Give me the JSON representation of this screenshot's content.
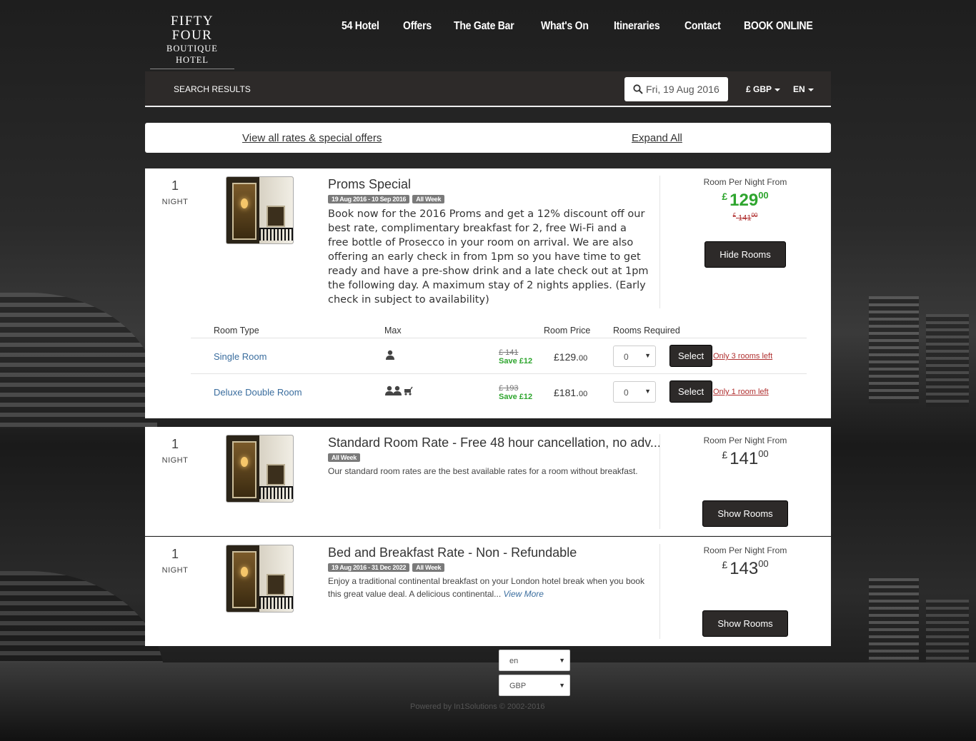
{
  "logo": {
    "line1": "FIFTY FOUR",
    "line2": "BOUTIQUE HOTEL"
  },
  "nav": [
    "54 Hotel",
    "Offers",
    "The Gate Bar",
    "What's On",
    "Itineraries",
    "Contact",
    "BOOK ONLINE"
  ],
  "search": {
    "title": "SEARCH RESULTS",
    "date": "Fri, 19 Aug 2016",
    "currency": "£ GBP",
    "language": "EN"
  },
  "links": {
    "view_all": "View all rates & special offers",
    "expand": "Expand All"
  },
  "rates": [
    {
      "nights": "1",
      "nights_label": "NIGHT",
      "title": "Proms Special",
      "badges": [
        "19 Aug 2016 - 10 Sep 2016",
        "All Week"
      ],
      "description": "Book now for the 2016 Proms and get a 12% discount off our best rate, complimentary breakfast for 2, free Wi-Fi and a free bottle of Prosecco in your room on arrival. We are also offering an early check in from 1pm so you have time to get ready and have a pre-show drink and a late check out at 1pm the following day. A maximum stay of 2 nights applies. (Early check in subject to availability)",
      "from_label": "Room Per Night From",
      "currency_symbol": "£",
      "price_main": "129",
      "price_cents": "00",
      "old_currency": "£",
      "old_main": "141",
      "old_cents": "00",
      "button": "Hide Rooms",
      "table_headers": {
        "type": "Room Type",
        "max": "Max",
        "price": "Room Price",
        "required": "Rooms Required"
      },
      "rooms": [
        {
          "name": "Single Room",
          "was": "£ 141",
          "save": "Save £12",
          "price": "£129.",
          "cents": "00",
          "qty": "0",
          "select": "Select",
          "left": "Only 3 rooms left"
        },
        {
          "name": "Deluxe Double Room",
          "was": "£ 193",
          "save": "Save £12",
          "price": "£181.",
          "cents": "00",
          "qty": "0",
          "select": "Select",
          "left": "Only 1 room left"
        }
      ]
    },
    {
      "nights": "1",
      "nights_label": "NIGHT",
      "title": "Standard Room Rate - Free 48 hour cancellation, no adv...",
      "badges": [
        "All Week"
      ],
      "description": "Our standard room rates are the best available rates for a room without breakfast.",
      "from_label": "Room Per Night From",
      "currency_symbol": "£",
      "price_main": "141",
      "price_cents": "00",
      "button": "Show Rooms"
    },
    {
      "nights": "1",
      "nights_label": "NIGHT",
      "title": "Bed and Breakfast Rate - Non - Refundable",
      "badges": [
        "19 Aug 2016 - 31 Dec 2022",
        "All Week"
      ],
      "description": "Enjoy a traditional continental breakfast on your London hotel break when you book this great value deal. A delicious continental...",
      "view_more": "View More",
      "from_label": "Room Per Night From",
      "currency_symbol": "£",
      "price_main": "143",
      "price_cents": "00",
      "button": "Show Rooms"
    }
  ],
  "footer": {
    "language": "en",
    "currency": "GBP",
    "powered": "Powered by In1Solutions © 2002-2016"
  },
  "colors": {
    "accent_green": "#2ea52e",
    "dark_bar": "#2d2a29",
    "warning_red": "#b03030",
    "link_blue": "#3a6d9e"
  }
}
